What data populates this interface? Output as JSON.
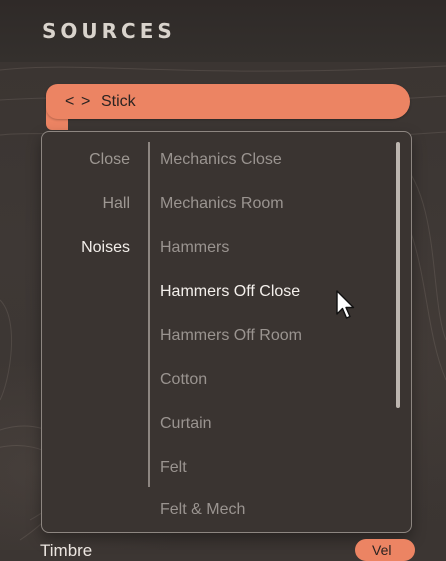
{
  "header": {
    "title": "SOURCES"
  },
  "selector": {
    "prev_glyph": "<",
    "next_glyph": ">",
    "label": "Stick"
  },
  "dropdown": {
    "categories": [
      {
        "label": "Close",
        "active": false
      },
      {
        "label": "Hall",
        "active": false
      },
      {
        "label": "Noises",
        "active": true
      }
    ],
    "sources": [
      {
        "label": "Mechanics Close"
      },
      {
        "label": "Mechanics Room"
      },
      {
        "label": "Hammers"
      },
      {
        "label": "Hammers Off Close",
        "hovered": true
      },
      {
        "label": "Hammers Off Room"
      },
      {
        "label": "Cotton"
      },
      {
        "label": "Curtain"
      },
      {
        "label": "Felt"
      },
      {
        "label": "Felt & Mech"
      }
    ]
  },
  "footer": {
    "label": "Timbre",
    "badge": "Vel"
  },
  "colors": {
    "accent": "#ec8463",
    "background": "#3c3633",
    "text_active": "#f4f0ec",
    "text_inactive": "#9a9490",
    "border": "#8d8681"
  },
  "icons": {
    "cursor": "arrow-cursor-icon",
    "prev": "chevron-left-icon",
    "next": "chevron-right-icon"
  }
}
